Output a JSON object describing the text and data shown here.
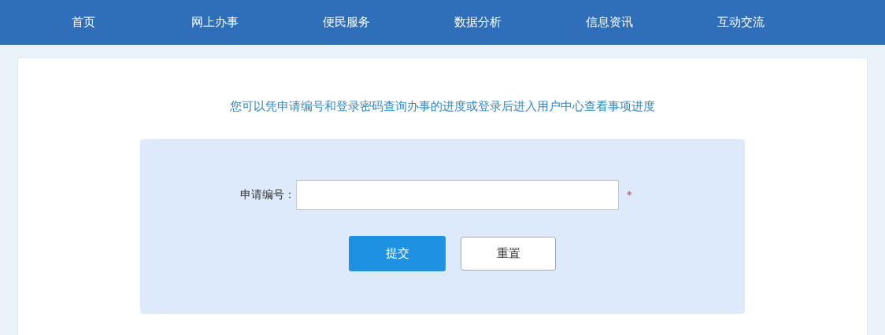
{
  "nav": {
    "items": [
      "首页",
      "网上办事",
      "便民服务",
      "数据分析",
      "信息资讯",
      "互动交流"
    ]
  },
  "intro": "您可以凭申请编号和登录密码查询办事的进度或登录后进入用户中心查看事项进度",
  "form": {
    "field": {
      "label": "申请编号：",
      "required_mark": "*"
    },
    "buttons": [
      {
        "label": "提交",
        "kind": "primary"
      },
      {
        "label": "重置",
        "kind": "secondary"
      }
    ]
  }
}
